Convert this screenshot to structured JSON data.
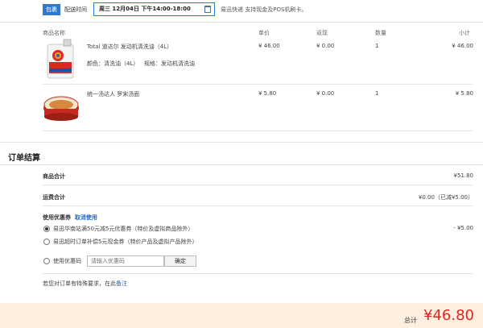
{
  "delivery": {
    "package_tag": "包裹",
    "time_label": "配送时间",
    "time_value": "周三 12月04日 下午14:00-18:00",
    "note": "易迅快递 支持现金及POS机刷卡。"
  },
  "table": {
    "headers": {
      "name": "商品名称",
      "price": "单价",
      "rebate": "返现",
      "qty": "数量",
      "subtotal": "小计"
    },
    "items": [
      {
        "name": "Total 道达尔 发动机清洗油（4L）",
        "color_label": "颜色：",
        "color": "清洗油（4L）",
        "spec_label": "规格：",
        "spec": "发动机清洗油",
        "price": "¥ 46.00",
        "rebate": "¥ 0.00",
        "qty": "1",
        "subtotal": "¥ 46.00"
      },
      {
        "name": "统一汤达人 罗宋汤面",
        "price": "¥ 5.80",
        "rebate": "¥ 0.00",
        "qty": "1",
        "subtotal": "¥ 5.80"
      }
    ]
  },
  "summary": {
    "title": "订单结算",
    "goods_label": "商品合计",
    "goods_value": "¥51.80",
    "shipping_label": "运费合计",
    "shipping_value": "¥0.00（已减¥5.00）",
    "coupon_title": "使用优惠券",
    "cancel_link": "取消使用",
    "coupons": [
      {
        "text": "易迅华南站满50元减5元优惠券（特价及虚拟商品除外）",
        "value": "- ¥5.00",
        "selected": true
      },
      {
        "text": "易迅超时订单补偿5元现金券（特价产品及虚拟产品除外）",
        "value": "",
        "selected": false
      }
    ],
    "code_label": "使用优惠码",
    "code_placeholder": "请输入优惠码",
    "code_button": "确定",
    "special_text": "若您对订单有特殊要求，在此",
    "special_link": "备注"
  },
  "total": {
    "label": "总计",
    "amount": "¥46.80"
  },
  "colors": {
    "accent": "#2f78d0",
    "price_red": "#e0261b",
    "total_bg": "#fdf0e1"
  },
  "icons": [
    "calendar-icon",
    "engine-oil-product-image",
    "noodle-bowl-product-image"
  ]
}
